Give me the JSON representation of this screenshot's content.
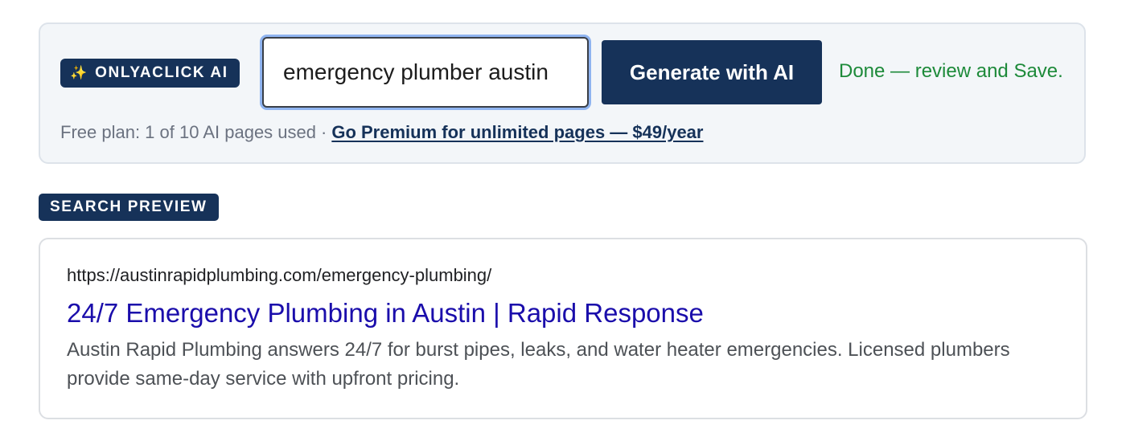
{
  "ai_panel": {
    "brand_icon": "sparkle-icon",
    "brand_icon_glyph": "✨",
    "brand_label": "ONLYACLICK AI",
    "keyword_value": "emergency plumber austin",
    "generate_button_label": "Generate with AI",
    "status_text": "Done — review and Save.",
    "plan_text": "Free plan: 1 of 10 AI pages used",
    "plan_separator": "·",
    "premium_link_text": "Go Premium for unlimited pages — $49/year",
    "colors": {
      "brand": "#163259",
      "status_success": "#1d8a3a",
      "panel_background": "#f3f6f9"
    }
  },
  "search_preview": {
    "label": "SEARCH PREVIEW",
    "url": "https://austinrapidplumbing.com/emergency-plumbing/",
    "title": "24/7 Emergency Plumbing in Austin | Rapid Response",
    "snippet": "Austin Rapid Plumbing answers 24/7 for burst pipes, leaks, and water heater emergencies. Licensed plumbers provide same-day service with upfront pricing.",
    "colors": {
      "title_link": "#1a0dab",
      "url_text": "#202124",
      "snippet_text": "#4d5156"
    }
  }
}
